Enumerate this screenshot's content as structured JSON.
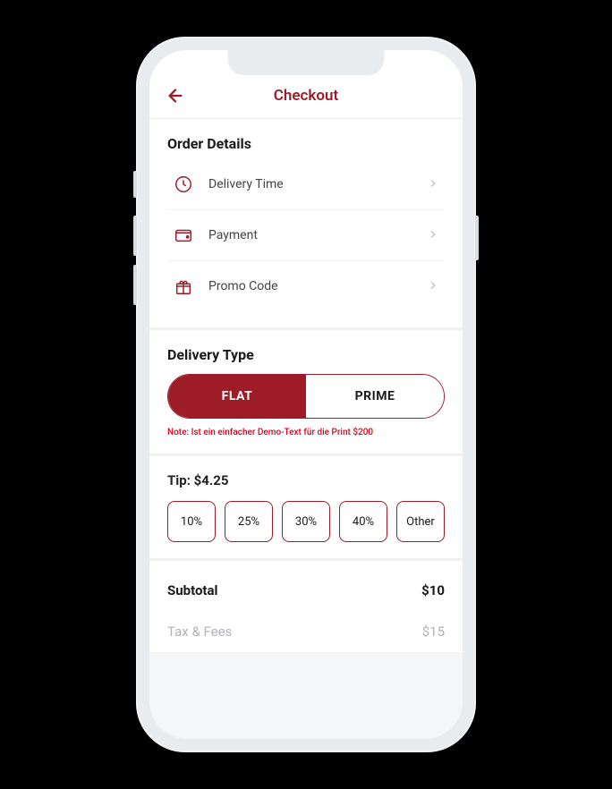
{
  "header": {
    "title": "Checkout"
  },
  "order_details": {
    "title": "Order Details",
    "items": [
      {
        "label": "Delivery Time",
        "icon": "clock-icon"
      },
      {
        "label": "Payment",
        "icon": "wallet-icon"
      },
      {
        "label": "Promo Code",
        "icon": "gift-icon"
      }
    ]
  },
  "delivery_type": {
    "title": "Delivery Type",
    "options": [
      {
        "label": "FLAT",
        "active": true
      },
      {
        "label": "PRIME",
        "active": false
      }
    ],
    "note": "Note: Ist ein einfacher Demo-Text für die Print $200"
  },
  "tip": {
    "title": "Tip: $4.25",
    "options": [
      "10%",
      "25%",
      "30%",
      "40%",
      "Other"
    ]
  },
  "totals": [
    {
      "label": "Subtotal",
      "value": "$10",
      "style": "strong"
    },
    {
      "label": "Tax & Fees",
      "value": "$15",
      "style": "muted"
    }
  ]
}
